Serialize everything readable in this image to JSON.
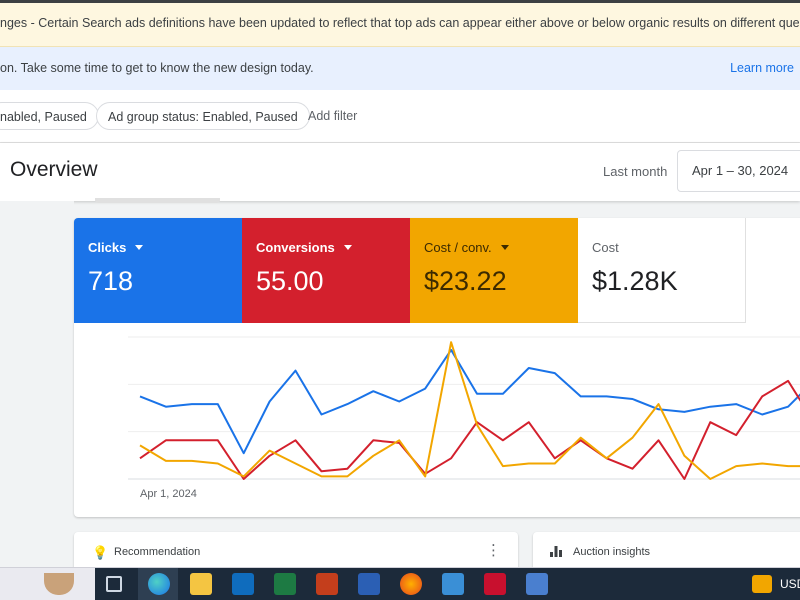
{
  "banner_notice": {
    "lead": "nges",
    "text": " - Certain Search ads definitions have been updated to reflect that top ads can appear either above or below organic results on different queries."
  },
  "banner_info": {
    "text": "on. Take some time to get to know the new design today.",
    "link": "Learn more"
  },
  "filters": {
    "chip1": "nabled, Paused",
    "chip2": "Ad group status: Enabled, Paused",
    "add": "Add filter"
  },
  "header": {
    "title": "Overview",
    "period_label": "Last month",
    "date_range": "Apr 1 – 30, 2024"
  },
  "metrics": [
    {
      "label": "Clicks",
      "value": "718",
      "color": "#1a73e8"
    },
    {
      "label": "Conversions",
      "value": "55.00",
      "color": "#d3202d"
    },
    {
      "label": "Cost / conv.",
      "value": "$23.22",
      "color": "#f2a600"
    },
    {
      "label": "Cost",
      "value": "$1.28K",
      "color": "#ffffff"
    }
  ],
  "chart_data": {
    "type": "line",
    "x_start_label": "Apr 1, 2024",
    "series": [
      {
        "name": "Clicks",
        "color": "#1a73e8",
        "values": [
          32,
          28,
          29,
          29,
          10,
          30,
          42,
          25,
          29,
          34,
          30,
          35,
          50,
          33,
          33,
          43,
          41,
          32,
          32,
          31,
          27,
          26,
          28,
          29,
          25,
          28,
          38
        ]
      },
      {
        "name": "Conversions",
        "color": "#d3202d",
        "values": [
          8,
          15,
          15,
          15,
          0,
          9,
          15,
          3,
          4,
          15,
          14,
          2,
          8,
          22,
          15,
          22,
          8,
          15,
          8,
          4,
          15,
          0,
          22,
          17,
          32,
          38,
          22
        ]
      },
      {
        "name": "Cost / conv.",
        "color": "#f2a600",
        "values": [
          13,
          7,
          7,
          6,
          1,
          11,
          6,
          1,
          1,
          9,
          15,
          1,
          53,
          21,
          5,
          6,
          6,
          16,
          8,
          16,
          29,
          9,
          0,
          5,
          6,
          5,
          5
        ]
      }
    ]
  },
  "bottom_cards": {
    "left": "Recommendation",
    "right": "Auction insights"
  },
  "taskbar": {
    "tray_text": "USD"
  }
}
